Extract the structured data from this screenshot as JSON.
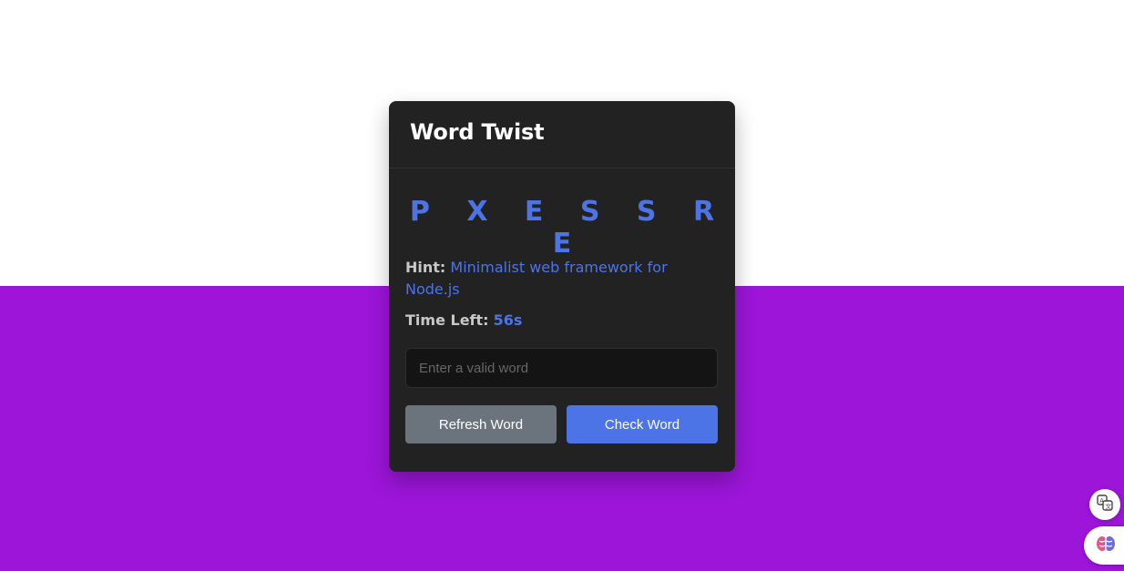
{
  "app": {
    "title": "Word Twist"
  },
  "game": {
    "scrambled_word": "P X E S S R E",
    "hint_label": "Hint:",
    "hint_text": "Minimalist web framework for Node.js",
    "timer_label": "Time Left:",
    "timer_value": "56s"
  },
  "input": {
    "placeholder": "Enter a valid word",
    "value": ""
  },
  "buttons": {
    "refresh_label": "Refresh Word",
    "check_label": "Check Word"
  },
  "floating": {
    "translate_icon": "translate-icon",
    "assistant_icon": "brain-icon"
  },
  "colors": {
    "accent": "#4d74e6",
    "background_purple": "#9c15d9",
    "card": "#222222",
    "refresh_button": "#6b747c"
  }
}
